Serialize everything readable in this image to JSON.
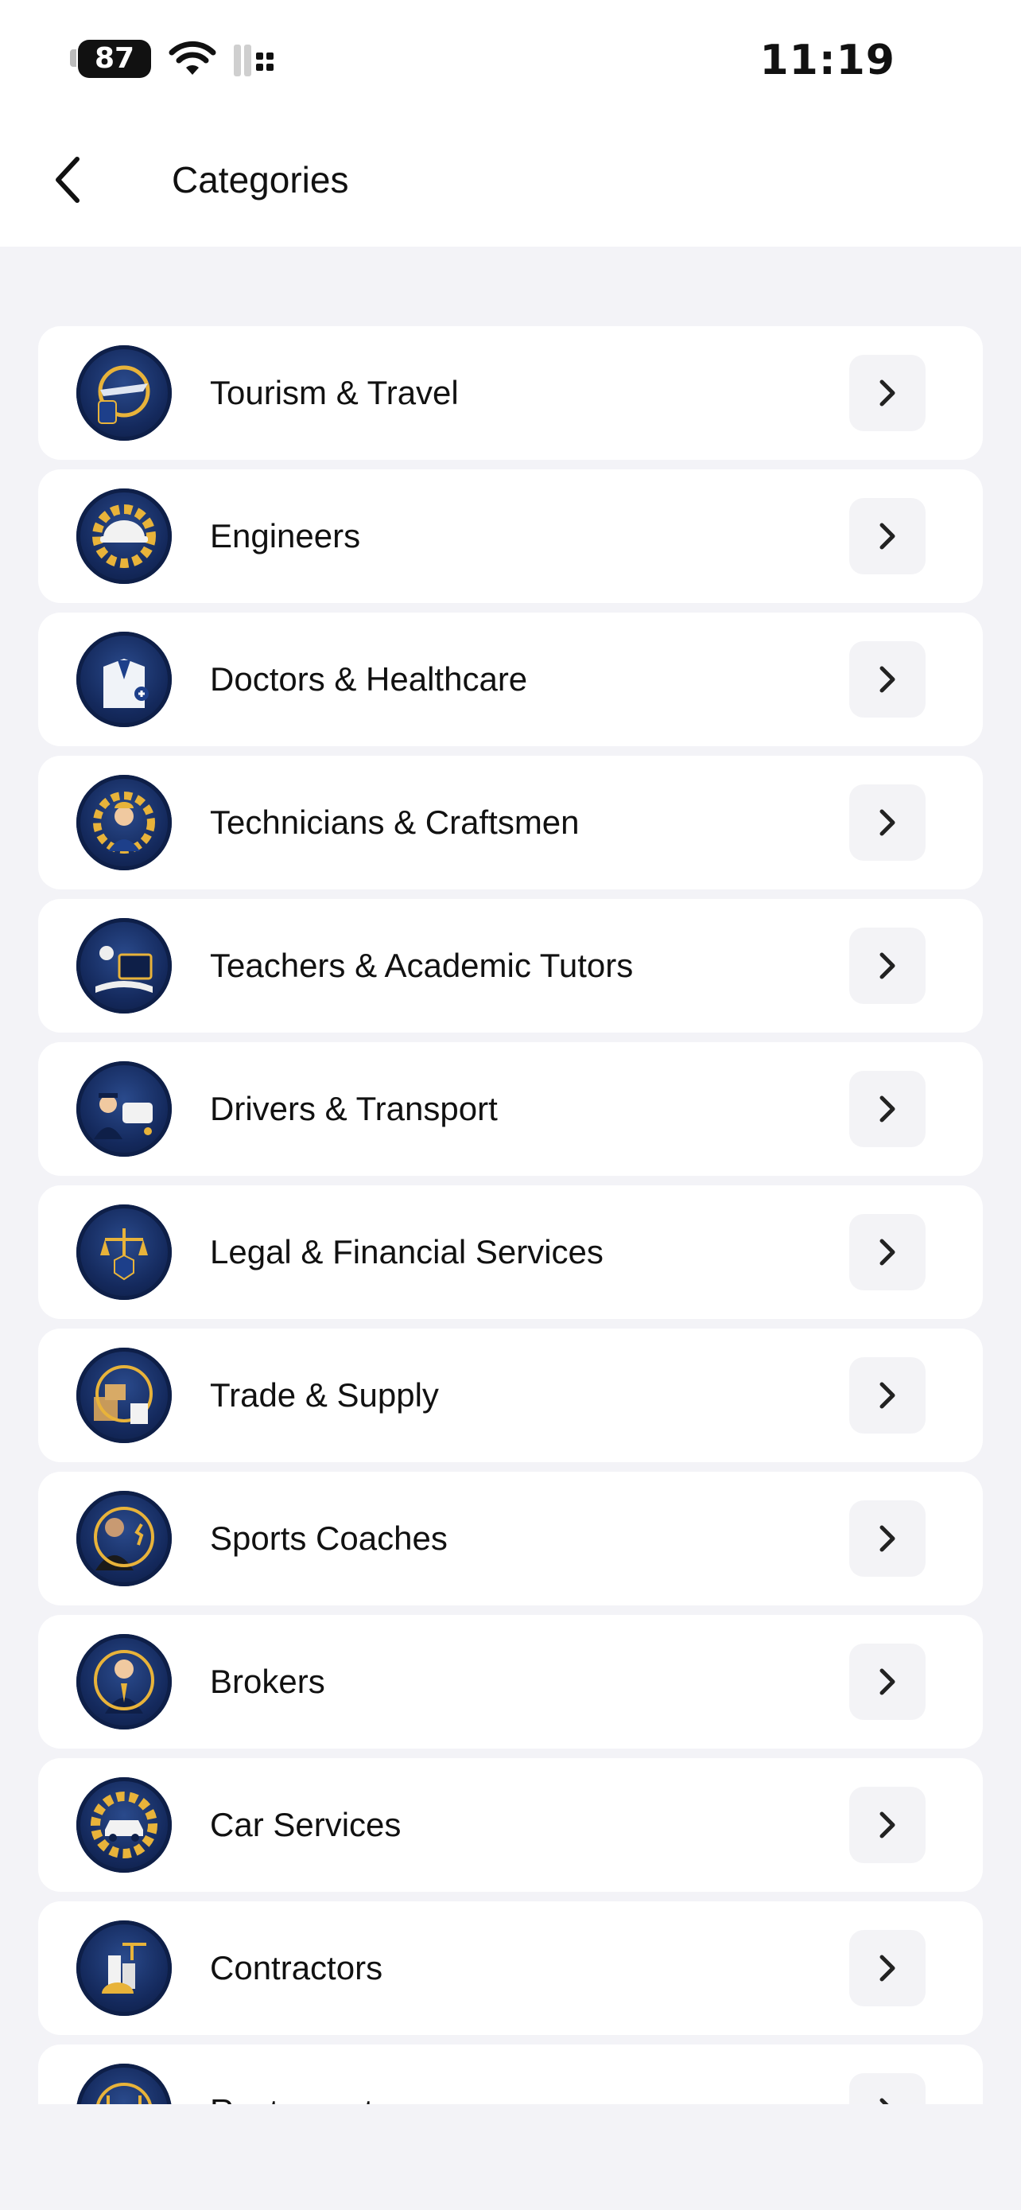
{
  "status_bar": {
    "battery": "87",
    "time": "11:19"
  },
  "header": {
    "title": "Categories"
  },
  "categories": [
    {
      "label": "Tourism & Travel",
      "icon": "travel-icon"
    },
    {
      "label": "Engineers",
      "icon": "engineer-icon"
    },
    {
      "label": "Doctors & Healthcare",
      "icon": "doctor-icon"
    },
    {
      "label": "Technicians & Craftsmen",
      "icon": "technician-icon"
    },
    {
      "label": "Teachers & Academic Tutors",
      "icon": "teacher-icon"
    },
    {
      "label": "Drivers & Transport",
      "icon": "driver-icon"
    },
    {
      "label": "Legal & Financial Services",
      "icon": "legal-icon"
    },
    {
      "label": "Trade & Supply",
      "icon": "trade-icon"
    },
    {
      "label": "Sports Coaches",
      "icon": "sports-icon"
    },
    {
      "label": "Brokers",
      "icon": "broker-icon"
    },
    {
      "label": "Car Services",
      "icon": "car-service-icon"
    },
    {
      "label": "Contractors",
      "icon": "contractor-icon"
    },
    {
      "label": "Restaurants",
      "icon": "restaurant-icon"
    }
  ],
  "colors": {
    "background": "#f3f3f7",
    "card": "#ffffff",
    "icon_navy": "#14295c",
    "icon_gold": "#e8b33a",
    "chevron_button": "#f3f3f6"
  }
}
